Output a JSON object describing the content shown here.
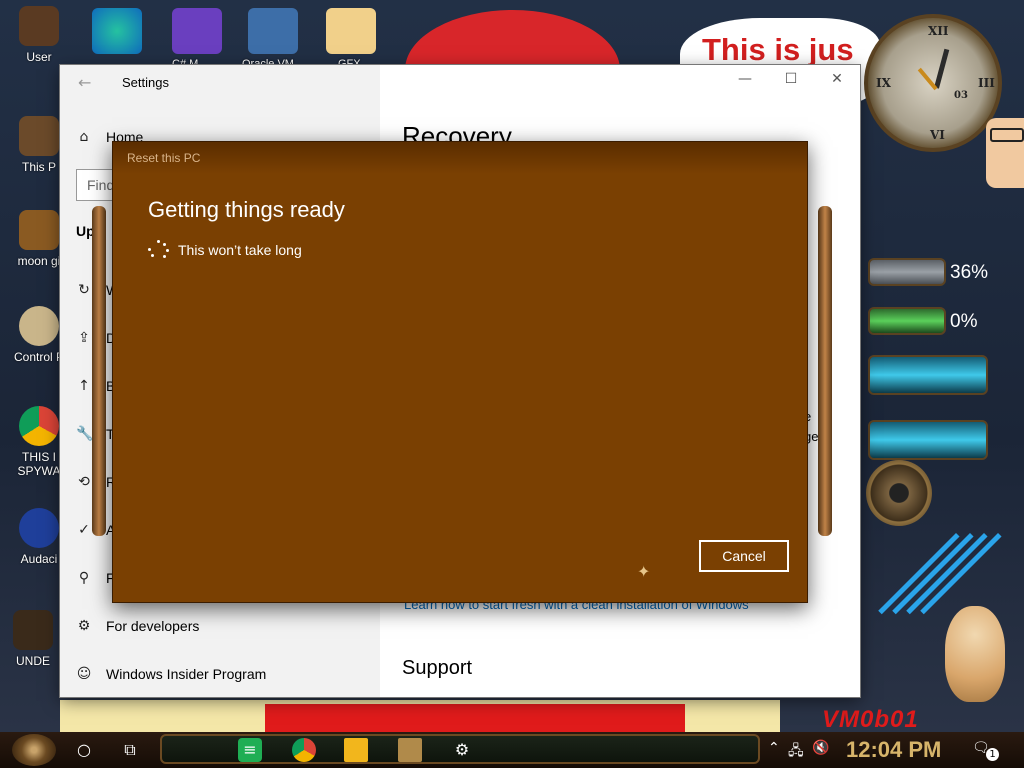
{
  "desktop": {
    "banner_text": "This is jus",
    "clock_numerals": [
      "XII",
      "III",
      "VI",
      "IX",
      "03"
    ],
    "meters": [
      {
        "label": "36%",
        "value": 36
      },
      {
        "label": "0%",
        "value": 0
      }
    ],
    "watermark": "VM0b01",
    "icons": [
      {
        "label": "User"
      },
      {
        "label": "This P"
      },
      {
        "label": "moon gi"
      },
      {
        "label": "Control P"
      },
      {
        "label": "THIS I"
      },
      {
        "label": "SPYWA"
      },
      {
        "label": "Audaci"
      },
      {
        "label": "UNDE"
      }
    ],
    "top_icons": [
      {
        "label": ""
      },
      {
        "label": "C# M"
      },
      {
        "label": "Oracle VM"
      },
      {
        "label": "GFX"
      }
    ]
  },
  "settings": {
    "title": "Settings",
    "back_icon": "back-arrow-icon",
    "minimize": "—",
    "maximize": "☐",
    "close": "✕",
    "search_placeholder": "Find",
    "nav": [
      {
        "icon": "home-icon",
        "glyph": "⌂",
        "label": "Home"
      },
      {
        "icon": "",
        "glyph": "",
        "label": "Upd"
      },
      {
        "icon": "refresh-icon",
        "glyph": "↻",
        "label": "W"
      },
      {
        "icon": "delivery-icon",
        "glyph": "⇪",
        "label": "D"
      },
      {
        "icon": "backup-icon",
        "glyph": "↑",
        "label": "B"
      },
      {
        "icon": "troubleshoot-icon",
        "glyph": "🔧",
        "label": "T"
      },
      {
        "icon": "recovery-icon",
        "glyph": "⟲",
        "label": "R"
      },
      {
        "icon": "activation-icon",
        "glyph": "✓",
        "label": "A"
      },
      {
        "icon": "find-device-icon",
        "glyph": "⚲",
        "label": "F"
      },
      {
        "icon": "developers-icon",
        "glyph": "⚙",
        "label": "For developers"
      },
      {
        "icon": "insider-icon",
        "glyph": "☺",
        "label": "Windows Insider Program"
      }
    ],
    "page_title": "Recovery",
    "text_fragment_1": "e",
    "text_fragment_2": "ge.",
    "learn_link": "Learn how to start fresh with a clean installation of Windows",
    "support_heading": "Support"
  },
  "dialog": {
    "title": "Reset this PC",
    "heading": "Getting things ready",
    "subtext": "This won’t take long",
    "cancel_label": "Cancel"
  },
  "taskbar": {
    "search_icon": "search-circle-icon",
    "task_view_icon": "task-view-icon",
    "pinned": [
      "notes-icon",
      "chrome-icon",
      "file-explorer-icon",
      "app-icon",
      "settings-gear-icon"
    ],
    "time": "12:04 PM",
    "tray_badge": "1"
  },
  "colors": {
    "dialog_bg": "#7a4002",
    "accent": "#0067b8"
  }
}
